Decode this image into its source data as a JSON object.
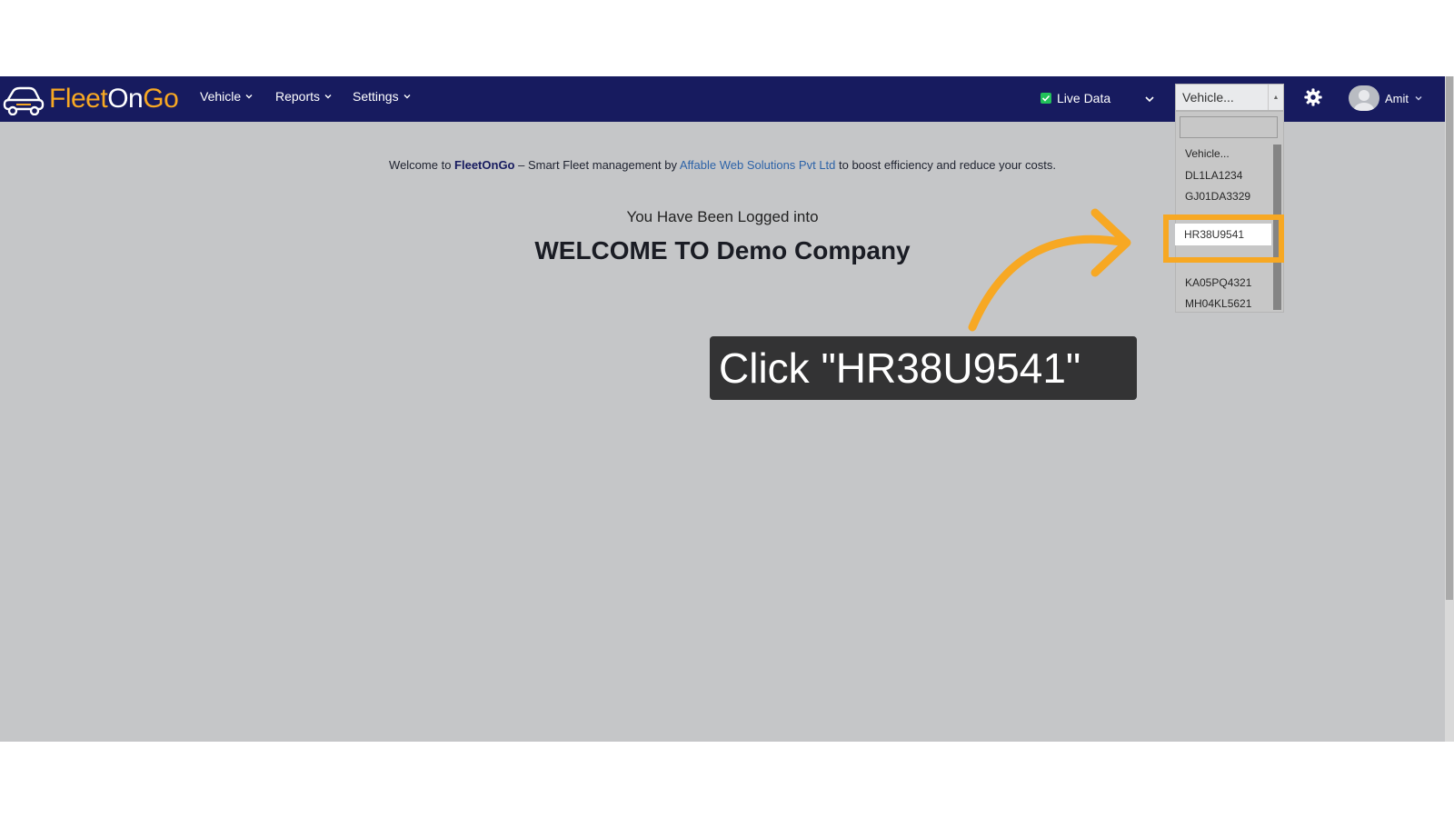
{
  "brand": {
    "part1": "Fleet",
    "part2": "On",
    "part3": "Go"
  },
  "nav": {
    "vehicle": "Vehicle",
    "reports": "Reports",
    "settings": "Settings"
  },
  "live_data": {
    "label": "Live Data"
  },
  "vehicle_select": {
    "selected": "Vehicle...",
    "options": [
      "Vehicle...",
      "DL1LA1234",
      "GJ01DA3329",
      "",
      "HR38U9541",
      "",
      "KA05PQ4321",
      "MH04KL5621"
    ]
  },
  "user": {
    "name": "Amit"
  },
  "welcome": {
    "prefix": "Welcome to ",
    "brand": "FleetOnGo",
    "middle": " – Smart Fleet management by ",
    "company_link": "Affable Web Solutions Pvt Ltd",
    "suffix": " to boost efficiency and reduce your costs."
  },
  "login": {
    "subtitle": "You Have Been Logged into",
    "title": "WELCOME TO Demo Company"
  },
  "tutorial": {
    "instruction": "Click \"HR38U9541\"",
    "target": "HR38U9541"
  },
  "colors": {
    "navbar": "#171b5f",
    "accent": "#f7a823",
    "background": "#c5c6c8",
    "callout": "#333334"
  }
}
